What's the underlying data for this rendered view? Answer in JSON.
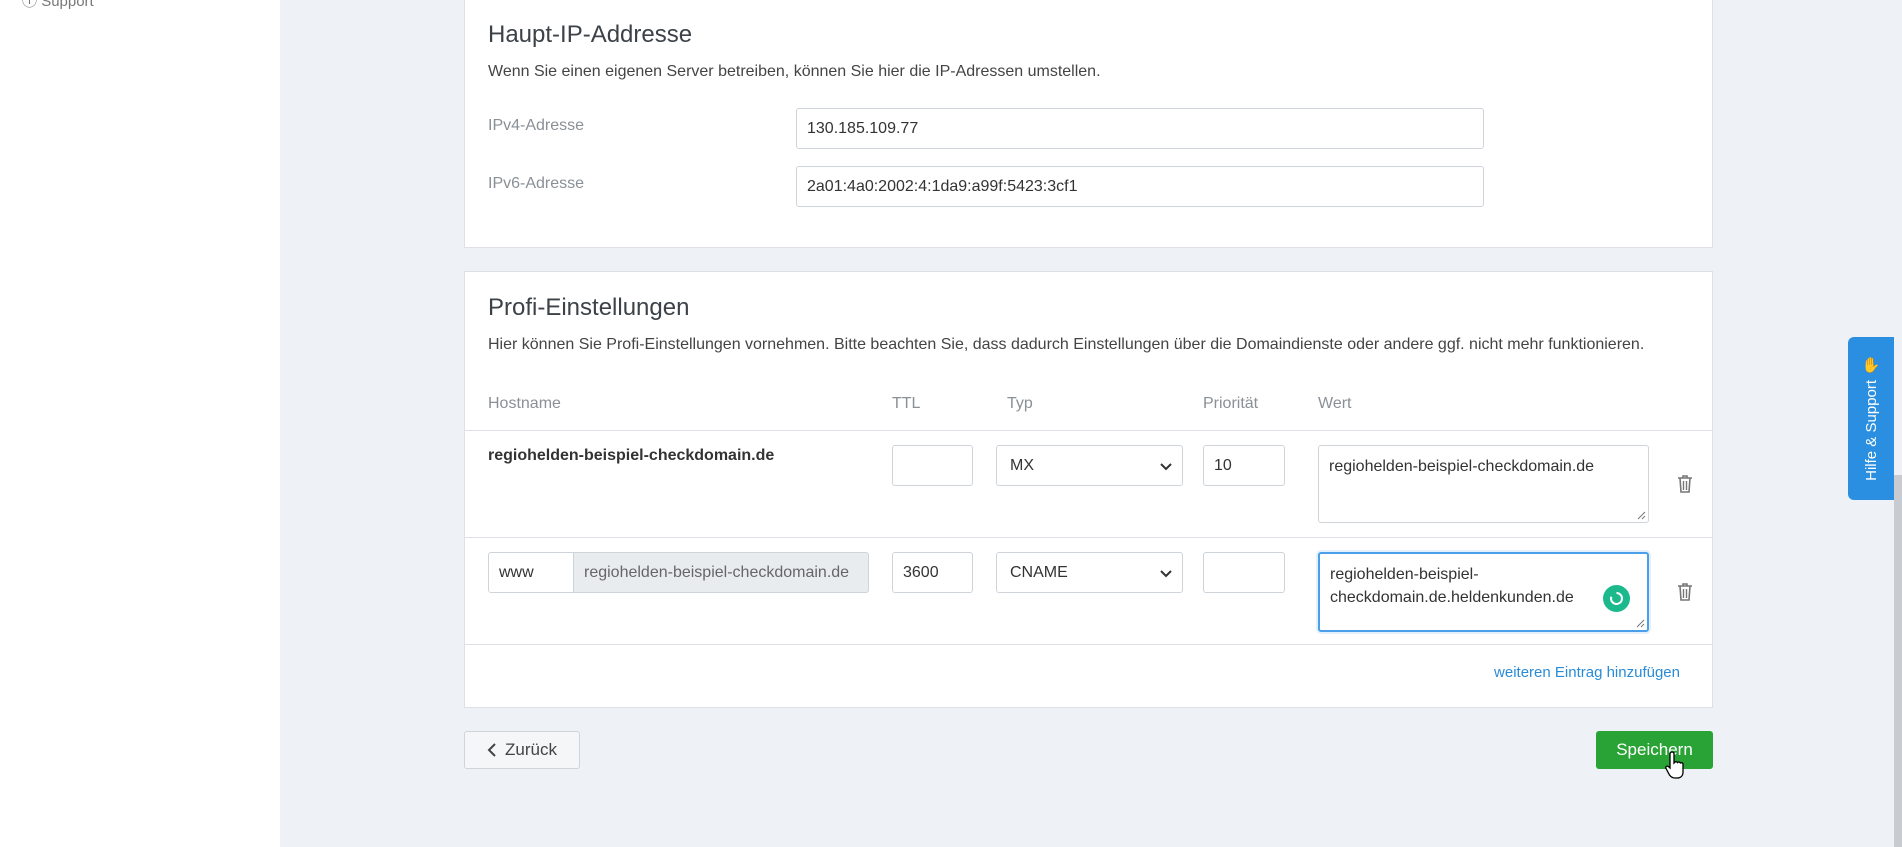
{
  "sidebar": {
    "stub_text": "Support"
  },
  "ip_section": {
    "title": "Haupt-IP-Addresse",
    "description": "Wenn Sie einen eigenen Server betreiben, können Sie hier die IP-Adressen umstellen.",
    "ipv4_label": "IPv4-Adresse",
    "ipv4_value": "130.185.109.77",
    "ipv6_label": "IPv6-Adresse",
    "ipv6_value": "2a01:4a0:2002:4:1da9:a99f:5423:3cf1"
  },
  "profi": {
    "title": "Profi-Einstellungen",
    "description": "Hier können Sie Profi-Einstellungen vornehmen. Bitte beachten Sie, dass dadurch Einstellungen über die Domaindienste oder andere ggf. nicht mehr funktionieren.",
    "columns": {
      "hostname": "Hostname",
      "ttl": "TTL",
      "typ": "Typ",
      "prioritaet": "Priorität",
      "wert": "Wert"
    },
    "rows": [
      {
        "hostname": "regiohelden-beispiel-checkdomain.de",
        "ttl": "",
        "typ": "MX",
        "prioritaet": "10",
        "wert": "regiohelden-beispiel-checkdomain.de"
      },
      {
        "hostname_prefix": "www",
        "hostname_suffix": "regiohelden-beispiel-checkdomain.de",
        "ttl": "3600",
        "typ": "CNAME",
        "prioritaet": "",
        "wert_line1": "regiohelden-beispiel-",
        "wert_line2": "checkdomain.de.heldenkunden.de"
      }
    ],
    "add_entry_link": "weiteren Eintrag hinzufügen"
  },
  "actions": {
    "back_label": "Zurück",
    "save_label": "Speichern"
  },
  "help_tab": {
    "label": "Hilfe & Support"
  },
  "colors": {
    "save_green": "#2aa336",
    "link_blue": "#2a8bd6",
    "help_blue": "#2a8fe0",
    "spinner_teal": "#1cb98d"
  }
}
